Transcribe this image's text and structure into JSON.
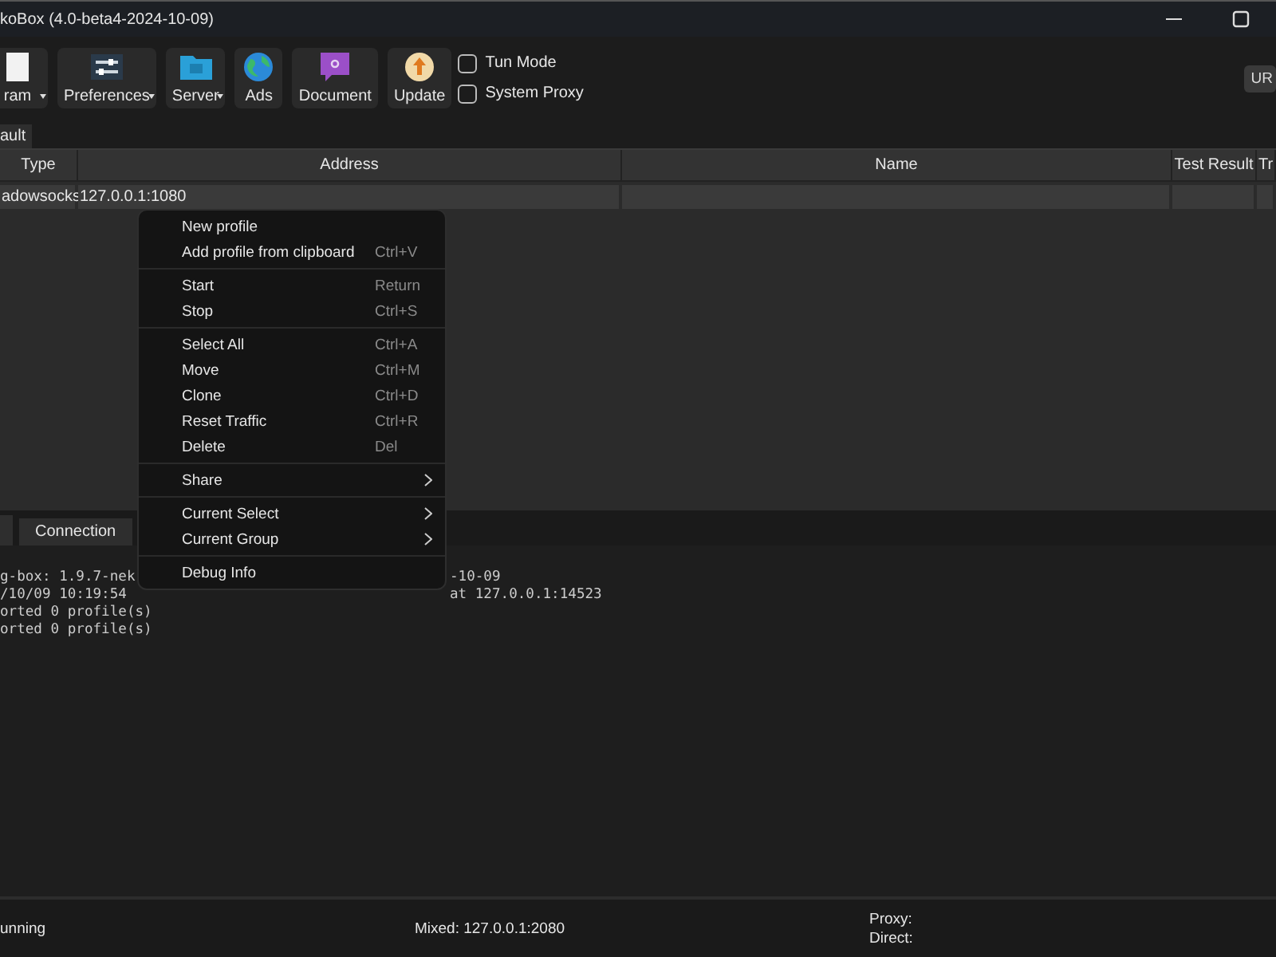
{
  "window": {
    "title": "koBox (4.0-beta4-2024-10-09)"
  },
  "toolbar": {
    "buttons": [
      {
        "label": "ram",
        "dropdown": true
      },
      {
        "label": "Preferences",
        "dropdown": true
      },
      {
        "label": "Server",
        "dropdown": true
      },
      {
        "label": "Ads",
        "dropdown": false
      },
      {
        "label": "Document",
        "dropdown": false
      },
      {
        "label": "Update",
        "dropdown": false
      }
    ],
    "checkboxes": [
      {
        "label": "Tun Mode",
        "checked": false
      },
      {
        "label": "System Proxy",
        "checked": false
      }
    ],
    "url_button": "UR"
  },
  "group_tabs": [
    {
      "label": "ault",
      "selected": true
    }
  ],
  "table": {
    "columns": [
      "Type",
      "Address",
      "Name",
      "Test Result",
      "Tr"
    ],
    "rows": [
      [
        "adowsocks",
        "127.0.0.1:1080",
        "",
        "",
        ""
      ]
    ]
  },
  "context_menu": [
    {
      "kind": "item",
      "label": "New profile"
    },
    {
      "kind": "item",
      "label": "Add profile from clipboard",
      "shortcut": "Ctrl+V"
    },
    {
      "kind": "separator"
    },
    {
      "kind": "item",
      "label": "Start",
      "shortcut": "Return"
    },
    {
      "kind": "item",
      "label": "Stop",
      "shortcut": "Ctrl+S"
    },
    {
      "kind": "separator"
    },
    {
      "kind": "item",
      "label": "Select All",
      "shortcut": "Ctrl+A"
    },
    {
      "kind": "item",
      "label": "Move",
      "shortcut": "Ctrl+M"
    },
    {
      "kind": "item",
      "label": "Clone",
      "shortcut": "Ctrl+D"
    },
    {
      "kind": "item",
      "label": "Reset Traffic",
      "shortcut": "Ctrl+R"
    },
    {
      "kind": "item",
      "label": "Delete",
      "shortcut": "Del"
    },
    {
      "kind": "separator"
    },
    {
      "kind": "submenu",
      "label": "Share"
    },
    {
      "kind": "separator"
    },
    {
      "kind": "submenu",
      "label": "Current Select"
    },
    {
      "kind": "submenu",
      "label": "Current Group"
    },
    {
      "kind": "separator"
    },
    {
      "kind": "item",
      "label": "Debug Info"
    }
  ],
  "bottom_tabs": [
    {
      "label": "Connection",
      "selected": false
    }
  ],
  "log": [
    {
      "left": "g-box: 1.9.7-nek",
      "right": "-10-09"
    },
    {
      "left": "/10/09 10:19:54",
      "right": "at 127.0.0.1:14523"
    },
    {
      "left": "orted 0 profile(s)"
    },
    {
      "left": "orted 0 profile(s)"
    }
  ],
  "status_bar": {
    "state": "unning",
    "mixed": "Mixed: 127.0.0.1:2080",
    "proxy": "Proxy:",
    "direct": "Direct:"
  }
}
